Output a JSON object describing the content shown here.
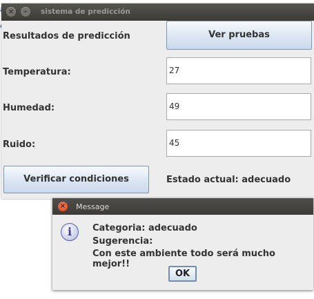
{
  "background": {
    "fragments": [
      "a",
      "e"
    ]
  },
  "main_window": {
    "title": "sistema de predicción",
    "close_glyph": "×",
    "minimize_glyph": "–",
    "results_label": "Resultados de predicción",
    "view_tests_button": "Ver pruebas",
    "temperature_label": "Temperatura:",
    "temperature_value": "27",
    "humidity_label": "Humedad:",
    "humidity_value": "49",
    "noise_label": "Ruido:",
    "noise_value": "45",
    "verify_button": "Verificar condiciones",
    "status_text": "Estado actual: adecuado"
  },
  "message_dialog": {
    "title": "Message",
    "close_glyph": "×",
    "icon_glyph": "i",
    "lines": [
      "Categoria: adecuado",
      "Sugerencia:",
      "Con este ambiente todo será mucho mejor!!"
    ],
    "ok_button": "OK"
  },
  "colors": {
    "titlebar": "#3b3a36",
    "window_bg": "#ededed",
    "button_gradient_bottom": "#c9d9ec",
    "dialog_close": "#e25a2c"
  }
}
